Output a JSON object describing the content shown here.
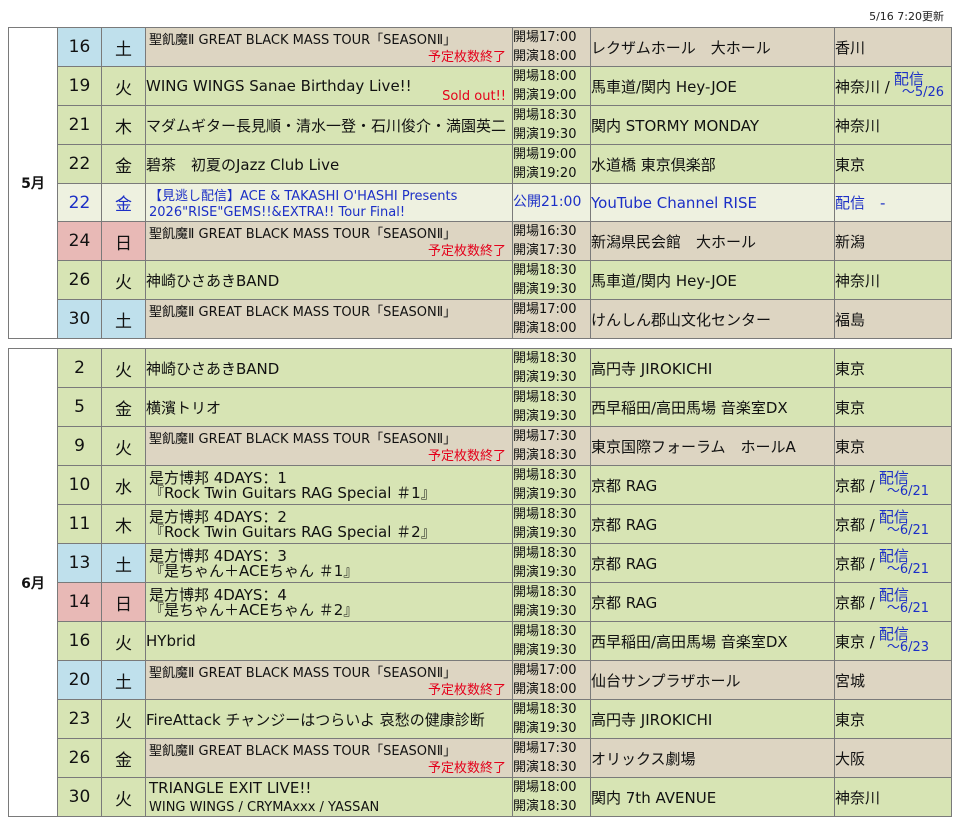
{
  "updated": "5/16 7:20更新",
  "months": [
    {
      "label": "5月",
      "rows": [
        {
          "day": "16",
          "weekday": "土",
          "kind": "sat",
          "title": "聖飢魔Ⅱ GREAT BLACK MASS TOUR「SEASONⅡ」",
          "note": "予定枚数終了",
          "title_size": "small",
          "open": "開場17:00",
          "start": "開演18:00",
          "venue": "レクザムホール　大ホール",
          "pref": "香川",
          "bg": "beige"
        },
        {
          "day": "19",
          "weekday": "火",
          "kind": "wk",
          "title": "WING WINGS Sanae Birthday Live!!",
          "note": "Sold out!!",
          "open": "開場18:00",
          "start": "開演19:00",
          "venue": "馬車道/関内 Hey-JOE",
          "pref": "神奈川 /",
          "stream_label": "配信",
          "stream_until": "〜5/26",
          "bg": "green"
        },
        {
          "day": "21",
          "weekday": "木",
          "kind": "wk",
          "title": "マダムギター長見順・清水一登・石川俊介・満園英二",
          "open": "開場18:30",
          "start": "開演19:30",
          "venue": "関内 STORMY MONDAY",
          "pref": "神奈川",
          "bg": "green"
        },
        {
          "day": "22",
          "weekday": "金",
          "kind": "wk",
          "title": "碧茶　初夏のJazz Club Live",
          "open": "開場19:00",
          "start": "開演19:20",
          "venue": "水道橋 東京倶楽部",
          "pref": "東京",
          "bg": "green"
        },
        {
          "day": "22",
          "weekday": "金",
          "kind": "stream",
          "title_line1": "【見逃し配信】ACE & TAKASHI O'HASHI Presents",
          "title_line2": "2026\"RISE\"GEMS!!&EXTRA!! Tour Final!",
          "single_time": "公開21:00",
          "venue": "YouTube Channel RISE",
          "pref": "配信　-",
          "bg": "stream"
        },
        {
          "day": "24",
          "weekday": "日",
          "kind": "sun",
          "title": "聖飢魔Ⅱ GREAT BLACK MASS TOUR「SEASONⅡ」",
          "note": "予定枚数終了",
          "title_size": "small",
          "open": "開場16:30",
          "start": "開演17:30",
          "venue": "新潟県民会館　大ホール",
          "pref": "新潟",
          "bg": "beige"
        },
        {
          "day": "26",
          "weekday": "火",
          "kind": "wk",
          "title": "神崎ひさあきBAND",
          "open": "開場18:30",
          "start": "開演19:30",
          "venue": "馬車道/関内 Hey-JOE",
          "pref": "神奈川",
          "bg": "green"
        },
        {
          "day": "30",
          "weekday": "土",
          "kind": "sat",
          "title": "聖飢魔Ⅱ GREAT BLACK MASS TOUR「SEASONⅡ」",
          "title_size": "small",
          "open": "開場17:00",
          "start": "開演18:00",
          "venue": "けんしん郡山文化センター",
          "pref": "福島",
          "bg": "beige"
        }
      ]
    },
    {
      "label": "6月",
      "rows": [
        {
          "day": "2",
          "weekday": "火",
          "kind": "wk",
          "title": "神崎ひさあきBAND",
          "open": "開場18:30",
          "start": "開演19:30",
          "venue": "高円寺 JIROKICHI",
          "pref": "東京",
          "bg": "green"
        },
        {
          "day": "5",
          "weekday": "金",
          "kind": "wk",
          "title": "横濱トリオ",
          "open": "開場18:30",
          "start": "開演19:30",
          "venue": "西早稲田/高田馬場 音楽室DX",
          "pref": "東京",
          "bg": "green"
        },
        {
          "day": "9",
          "weekday": "火",
          "kind": "wk",
          "title": "聖飢魔Ⅱ GREAT BLACK MASS TOUR「SEASONⅡ」",
          "note": "予定枚数終了",
          "title_size": "small",
          "open": "開場17:30",
          "start": "開演18:30",
          "venue": "東京国際フォーラム　ホールA",
          "pref": "東京",
          "bg": "beige"
        },
        {
          "day": "10",
          "weekday": "水",
          "kind": "wk",
          "title_line1": "是方博邦 4DAYS：1",
          "title_line2": "『Rock Twin Guitars RAG Special ＃1』",
          "open": "開場18:30",
          "start": "開演19:30",
          "venue": "京都 RAG",
          "pref": "京都 /",
          "stream_label": "配信",
          "stream_until": "〜6/21",
          "bg": "green"
        },
        {
          "day": "11",
          "weekday": "木",
          "kind": "wk",
          "title_line1": "是方博邦 4DAYS：2",
          "title_line2": "『Rock Twin Guitars RAG Special ＃2』",
          "open": "開場18:30",
          "start": "開演19:30",
          "venue": "京都 RAG",
          "pref": "京都 /",
          "stream_label": "配信",
          "stream_until": "〜6/21",
          "bg": "green"
        },
        {
          "day": "13",
          "weekday": "土",
          "kind": "sat",
          "title_line1": "是方博邦 4DAYS：3",
          "title_line2": "『是ちゃん＋ACEちゃん ＃1』",
          "open": "開場18:30",
          "start": "開演19:30",
          "venue": "京都 RAG",
          "pref": "京都 /",
          "stream_label": "配信",
          "stream_until": "〜6/21",
          "bg": "green"
        },
        {
          "day": "14",
          "weekday": "日",
          "kind": "sun",
          "title_line1": "是方博邦 4DAYS：4",
          "title_line2": "『是ちゃん＋ACEちゃん ＃2』",
          "open": "開場18:30",
          "start": "開演19:30",
          "venue": "京都 RAG",
          "pref": "京都 /",
          "stream_label": "配信",
          "stream_until": "〜6/21",
          "bg": "green"
        },
        {
          "day": "16",
          "weekday": "火",
          "kind": "wk",
          "title": "HYbrid",
          "open": "開場18:30",
          "start": "開演19:30",
          "venue": "西早稲田/高田馬場 音楽室DX",
          "pref": "東京 /",
          "stream_label": "配信",
          "stream_until": "〜6/23",
          "bg": "green"
        },
        {
          "day": "20",
          "weekday": "土",
          "kind": "sat",
          "title": "聖飢魔Ⅱ GREAT BLACK MASS TOUR「SEASONⅡ」",
          "note": "予定枚数終了",
          "title_size": "small",
          "open": "開場17:00",
          "start": "開演18:00",
          "venue": "仙台サンプラザホール",
          "pref": "宮城",
          "bg": "beige"
        },
        {
          "day": "23",
          "weekday": "火",
          "kind": "wk",
          "title": "FireAttack チャンジーはつらいよ 哀愁の健康診断",
          "open": "開場18:30",
          "start": "開演19:30",
          "venue": "高円寺 JIROKICHI",
          "pref": "東京",
          "bg": "green"
        },
        {
          "day": "26",
          "weekday": "金",
          "kind": "wk",
          "title": "聖飢魔Ⅱ GREAT BLACK MASS TOUR「SEASONⅡ」",
          "note": "予定枚数終了",
          "title_size": "small",
          "open": "開場17:30",
          "start": "開演18:30",
          "venue": "オリックス劇場",
          "pref": "大阪",
          "bg": "beige"
        },
        {
          "day": "30",
          "weekday": "火",
          "kind": "wk",
          "title_line1": "TRIANGLE EXIT LIVE!!",
          "title_line2": "WING WINGS / CRYMAxxx / YASSAN",
          "title2_size": "small",
          "open": "開場18:00",
          "start": "開演18:30",
          "venue": "関内 7th AVENUE",
          "pref": "神奈川",
          "bg": "green"
        }
      ]
    }
  ],
  "colors": {
    "sat": "#bfe0ec",
    "sun": "#e8b9b6",
    "weekday": "#d7e4b4",
    "beige": "#ddd5c2",
    "stream_row": "#eef1e0",
    "link": "#1c2fc6",
    "soldout": "#e4001b"
  }
}
